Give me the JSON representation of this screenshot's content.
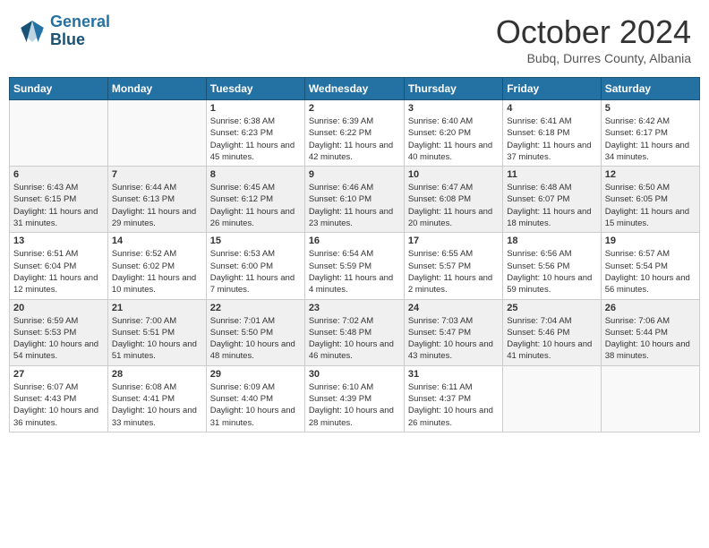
{
  "header": {
    "logo_line1": "General",
    "logo_line2": "Blue",
    "month": "October 2024",
    "location": "Bubq, Durres County, Albania"
  },
  "days_of_week": [
    "Sunday",
    "Monday",
    "Tuesday",
    "Wednesday",
    "Thursday",
    "Friday",
    "Saturday"
  ],
  "weeks": [
    [
      {
        "day": "",
        "info": ""
      },
      {
        "day": "",
        "info": ""
      },
      {
        "day": "1",
        "info": "Sunrise: 6:38 AM\nSunset: 6:23 PM\nDaylight: 11 hours and 45 minutes."
      },
      {
        "day": "2",
        "info": "Sunrise: 6:39 AM\nSunset: 6:22 PM\nDaylight: 11 hours and 42 minutes."
      },
      {
        "day": "3",
        "info": "Sunrise: 6:40 AM\nSunset: 6:20 PM\nDaylight: 11 hours and 40 minutes."
      },
      {
        "day": "4",
        "info": "Sunrise: 6:41 AM\nSunset: 6:18 PM\nDaylight: 11 hours and 37 minutes."
      },
      {
        "day": "5",
        "info": "Sunrise: 6:42 AM\nSunset: 6:17 PM\nDaylight: 11 hours and 34 minutes."
      }
    ],
    [
      {
        "day": "6",
        "info": "Sunrise: 6:43 AM\nSunset: 6:15 PM\nDaylight: 11 hours and 31 minutes."
      },
      {
        "day": "7",
        "info": "Sunrise: 6:44 AM\nSunset: 6:13 PM\nDaylight: 11 hours and 29 minutes."
      },
      {
        "day": "8",
        "info": "Sunrise: 6:45 AM\nSunset: 6:12 PM\nDaylight: 11 hours and 26 minutes."
      },
      {
        "day": "9",
        "info": "Sunrise: 6:46 AM\nSunset: 6:10 PM\nDaylight: 11 hours and 23 minutes."
      },
      {
        "day": "10",
        "info": "Sunrise: 6:47 AM\nSunset: 6:08 PM\nDaylight: 11 hours and 20 minutes."
      },
      {
        "day": "11",
        "info": "Sunrise: 6:48 AM\nSunset: 6:07 PM\nDaylight: 11 hours and 18 minutes."
      },
      {
        "day": "12",
        "info": "Sunrise: 6:50 AM\nSunset: 6:05 PM\nDaylight: 11 hours and 15 minutes."
      }
    ],
    [
      {
        "day": "13",
        "info": "Sunrise: 6:51 AM\nSunset: 6:04 PM\nDaylight: 11 hours and 12 minutes."
      },
      {
        "day": "14",
        "info": "Sunrise: 6:52 AM\nSunset: 6:02 PM\nDaylight: 11 hours and 10 minutes."
      },
      {
        "day": "15",
        "info": "Sunrise: 6:53 AM\nSunset: 6:00 PM\nDaylight: 11 hours and 7 minutes."
      },
      {
        "day": "16",
        "info": "Sunrise: 6:54 AM\nSunset: 5:59 PM\nDaylight: 11 hours and 4 minutes."
      },
      {
        "day": "17",
        "info": "Sunrise: 6:55 AM\nSunset: 5:57 PM\nDaylight: 11 hours and 2 minutes."
      },
      {
        "day": "18",
        "info": "Sunrise: 6:56 AM\nSunset: 5:56 PM\nDaylight: 10 hours and 59 minutes."
      },
      {
        "day": "19",
        "info": "Sunrise: 6:57 AM\nSunset: 5:54 PM\nDaylight: 10 hours and 56 minutes."
      }
    ],
    [
      {
        "day": "20",
        "info": "Sunrise: 6:59 AM\nSunset: 5:53 PM\nDaylight: 10 hours and 54 minutes."
      },
      {
        "day": "21",
        "info": "Sunrise: 7:00 AM\nSunset: 5:51 PM\nDaylight: 10 hours and 51 minutes."
      },
      {
        "day": "22",
        "info": "Sunrise: 7:01 AM\nSunset: 5:50 PM\nDaylight: 10 hours and 48 minutes."
      },
      {
        "day": "23",
        "info": "Sunrise: 7:02 AM\nSunset: 5:48 PM\nDaylight: 10 hours and 46 minutes."
      },
      {
        "day": "24",
        "info": "Sunrise: 7:03 AM\nSunset: 5:47 PM\nDaylight: 10 hours and 43 minutes."
      },
      {
        "day": "25",
        "info": "Sunrise: 7:04 AM\nSunset: 5:46 PM\nDaylight: 10 hours and 41 minutes."
      },
      {
        "day": "26",
        "info": "Sunrise: 7:06 AM\nSunset: 5:44 PM\nDaylight: 10 hours and 38 minutes."
      }
    ],
    [
      {
        "day": "27",
        "info": "Sunrise: 6:07 AM\nSunset: 4:43 PM\nDaylight: 10 hours and 36 minutes."
      },
      {
        "day": "28",
        "info": "Sunrise: 6:08 AM\nSunset: 4:41 PM\nDaylight: 10 hours and 33 minutes."
      },
      {
        "day": "29",
        "info": "Sunrise: 6:09 AM\nSunset: 4:40 PM\nDaylight: 10 hours and 31 minutes."
      },
      {
        "day": "30",
        "info": "Sunrise: 6:10 AM\nSunset: 4:39 PM\nDaylight: 10 hours and 28 minutes."
      },
      {
        "day": "31",
        "info": "Sunrise: 6:11 AM\nSunset: 4:37 PM\nDaylight: 10 hours and 26 minutes."
      },
      {
        "day": "",
        "info": ""
      },
      {
        "day": "",
        "info": ""
      }
    ]
  ]
}
